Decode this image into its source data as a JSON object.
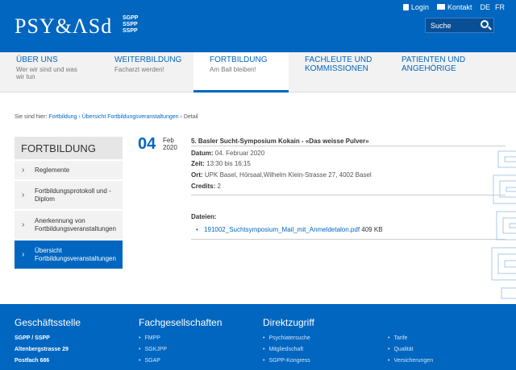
{
  "header": {
    "logo": "PSY&ΛSd",
    "logo_sub": [
      "SGPP",
      "SSPP",
      "SSPP"
    ],
    "login": "Login",
    "contact": "Kontakt",
    "lang_de": "DE",
    "lang_fr": "FR",
    "search_placeholder": "Suche"
  },
  "nav": [
    {
      "title": "ÜBER UNS",
      "sub": "Wer wir sind und was wir tun"
    },
    {
      "title": "WEITERBILDUNG",
      "sub": "Facharzt werden!"
    },
    {
      "title": "FORTBILDUNG",
      "sub": "Am Ball bleiben!"
    },
    {
      "title": "FACHLEUTE UND KOMMISSIONEN",
      "sub": ""
    },
    {
      "title": "PATIENTEN UND ANGEHÖRIGE",
      "sub": ""
    }
  ],
  "breadcrumb": {
    "prefix": "Sie sind hier:",
    "item1": "Fortbildung",
    "sep": "›",
    "item2": "Übersicht Fortbildungsveranstaltungen",
    "item3": "Detail"
  },
  "sidebar": {
    "title": "FORTBILDUNG",
    "items": [
      {
        "label": "Reglemente"
      },
      {
        "label": "Fortbildungsprotokoll und -Diplom"
      },
      {
        "label": "Anerkennung von Fortbildungsveranstaltungen"
      },
      {
        "label": "Übersicht Fortbildungsveranstaltungen"
      }
    ]
  },
  "event": {
    "day": "04",
    "month": "Feb",
    "year": "2020",
    "title": "5. Basler Sucht-Symposium Kokain - «Das weisse Pulver»",
    "date_label": "Datum:",
    "date_value": "04. Februar 2020",
    "time_label": "Zeit:",
    "time_value": "13:30 bis 16:15",
    "place_label": "Ort:",
    "place_value": "UPK Basel, Hörsaal,Wilhelm Klein-Strasse 27, 4002 Basel",
    "credits_label": "Credits:",
    "credits_value": "2",
    "files_label": "Dateien:",
    "file_name": "191002_Suchtsymposium_Mail_mit_Anmeldetalon.pdf",
    "file_size": "409 KB"
  },
  "footer": {
    "col1_title": "Geschäftsstelle",
    "col1_lines": [
      "SGPP / SSPP",
      "Altenbergstrasse 29",
      "Postfach 686"
    ],
    "col2_title": "Fachgesellschaften",
    "col2_links": [
      "FMPP",
      "SGKJPP",
      "SGAP"
    ],
    "col3_title": "Direktzugriff",
    "col3_links": [
      "Psychiatersuche",
      "Mitgliedschaft",
      "SGPP-Kongress"
    ],
    "col4_links": [
      "Tarife",
      "Qualität",
      "Versicherungen"
    ]
  },
  "colors": {
    "brand_blue": "#0066c0",
    "nav_bg": "#f2f2f2"
  }
}
